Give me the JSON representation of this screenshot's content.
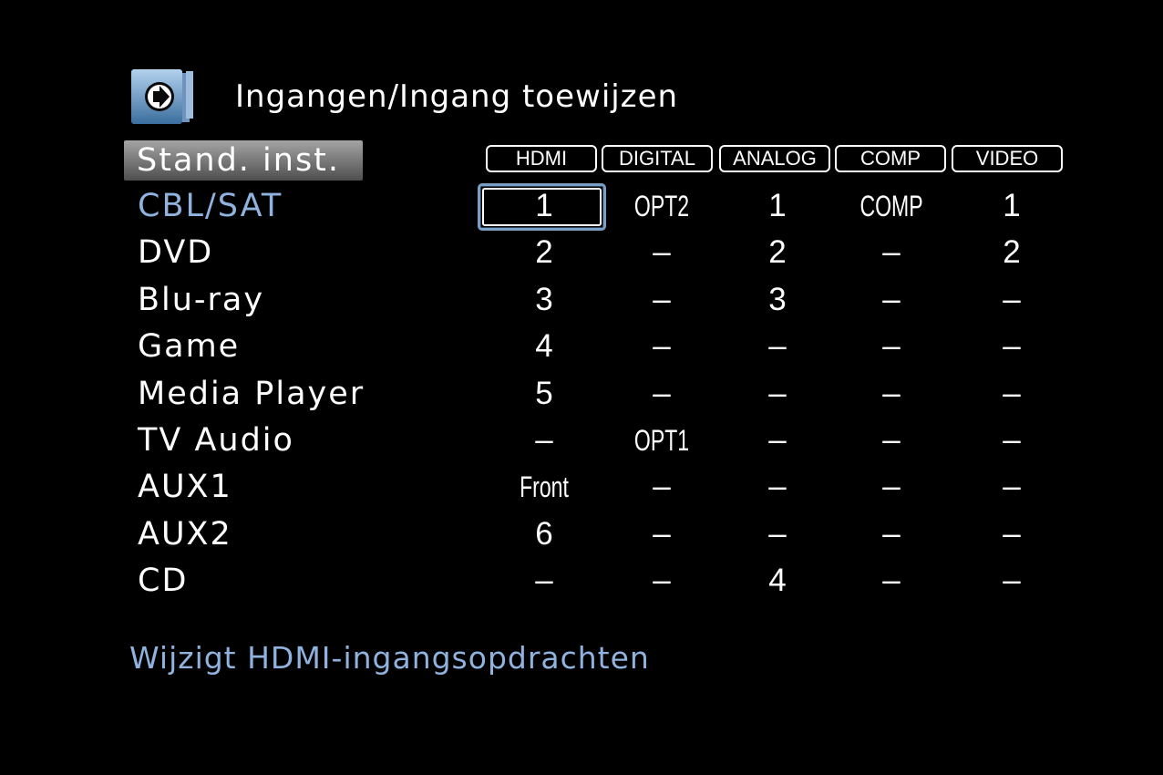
{
  "header": {
    "icon": "input-assign-arrow-icon",
    "title": "Ingangen/Ingang toewijzen"
  },
  "defaults_button": "Stand. inst.",
  "columns": [
    "HDMI",
    "DIGITAL",
    "ANALOG",
    "COMP",
    "VIDEO"
  ],
  "rows": [
    {
      "label": "CBL/SAT",
      "cells": [
        "1",
        "OPT2",
        "1",
        "COMP",
        "1"
      ]
    },
    {
      "label": "DVD",
      "cells": [
        "2",
        "–",
        "2",
        "–",
        "2"
      ]
    },
    {
      "label": "Blu-ray",
      "cells": [
        "3",
        "–",
        "3",
        "–",
        "–"
      ]
    },
    {
      "label": "Game",
      "cells": [
        "4",
        "–",
        "–",
        "–",
        "–"
      ]
    },
    {
      "label": "Media Player",
      "cells": [
        "5",
        "–",
        "–",
        "–",
        "–"
      ]
    },
    {
      "label": "TV Audio",
      "cells": [
        "–",
        "OPT1",
        "–",
        "–",
        "–"
      ]
    },
    {
      "label": "AUX1",
      "cells": [
        "Front",
        "–",
        "–",
        "–",
        "–"
      ]
    },
    {
      "label": "AUX2",
      "cells": [
        "6",
        "–",
        "–",
        "–",
        "–"
      ]
    },
    {
      "label": "CD",
      "cells": [
        "–",
        "–",
        "4",
        "–",
        "–"
      ]
    }
  ],
  "selected": {
    "row": "CBL/SAT",
    "column": "HDMI"
  },
  "help_text": "Wijzigt HDMI-ingangsopdrachten",
  "colors": {
    "background": "#000000",
    "text": "#ffffff",
    "highlight": "#8fb2de",
    "focus_border": "#7a9fc6"
  }
}
